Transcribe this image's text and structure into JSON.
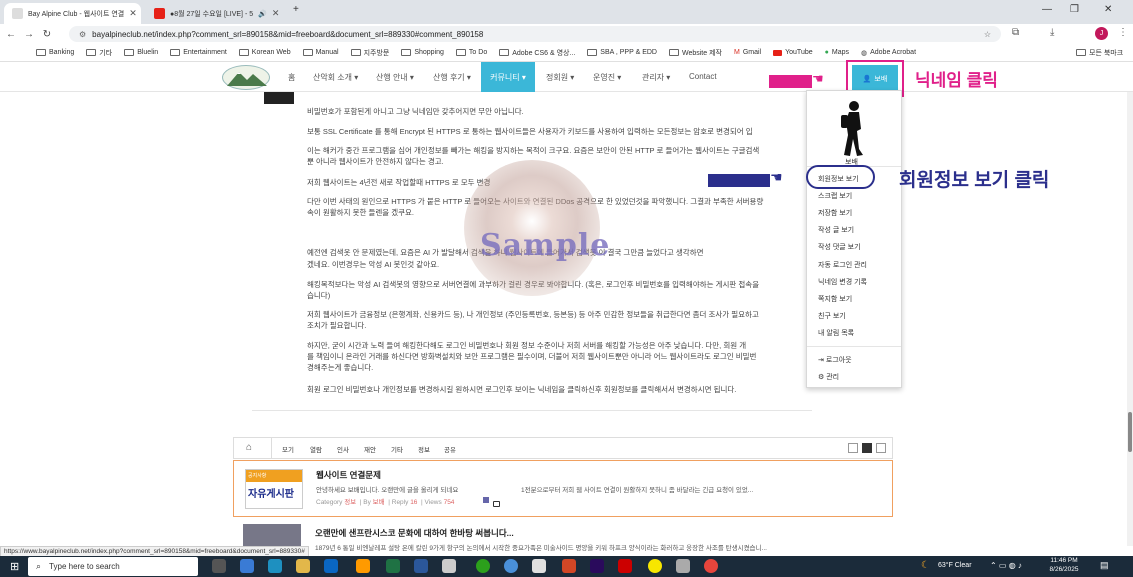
{
  "browser": {
    "tabs": [
      {
        "label": "Bay Alpine Club - 웹사이트 연결",
        "active": true
      },
      {
        "label": "●8월 27일 수요일 [LIVE] - 5",
        "active": false
      }
    ],
    "url": "bayalpineclub.net/index.php?comment_srl=890158&mid=freeboard&document_srl=889330#comment_890158",
    "bookmarks": [
      "Banking",
      "기타",
      "Bluelin",
      "Entertainment",
      "Korean Web",
      "Manual",
      "지주방문",
      "Shopping",
      "To Do",
      "Adobe CS6 & 영상...",
      "SBA , PPP & EDD",
      "Website 제작",
      "Gmail",
      "YouTube",
      "Maps",
      "Adobe Acrobat"
    ],
    "bookmarks_more": "모든 북마크",
    "status_url": "https://www.bayalpineclub.net/index.php?comment_srl=890158&mid=freeboard&document_srl=889330#"
  },
  "site": {
    "nav": [
      "홈",
      "산악회 소개 ▾",
      "산행 안내 ▾",
      "산행 후기 ▾",
      "커뮤니티 ▾",
      "정회원 ▾",
      "운영진 ▾",
      "관리자 ▾",
      "Contact"
    ],
    "user_button": "보배"
  },
  "article": {
    "lines": [
      "비밀번호가 포함된게 아니고 그냥 닉네임만 갖추어지면 무안 아닙니다.",
      "보통 SSL Certificate 를 통해 Encrypt 된 HTTPS 로 통하는 웹사이트들은 사용자가 키보드를 사용하여 입력하는 모든정보는 암호로 변경되어 입",
      "이는 해커가 중간 프로그램을 심어 개인정보를 빼가는 해킹을 방지하는 목적이 크구요. 요즘은 보안이 안된 HTTP 로 들어가는 웹사이트는 구글검색",
      "뿐 아니라 웹사이트가 안전하지 않다는 경고.",
      "저희 웹사이트는 4년전 새로 작업할때 HTTPS 로 모두 변경",
      "다만 이번 사태의 원인으로 HTTPS 가 붙은 HTTP 로 들어오는 사이트와 연결된 DDos 공격으로 한 있었던것을 파악했니다. 그결과 부족한 서버용량",
      "속이 원활하지 못한 들렌을 겠쿠요.",
      "예전엔 검색옷 안 문제였는데, 요즘은 AI 가 발달해서 검색을 하니 웹사이트에 들어가서 검색못 이 결국 그만큼 늘었다고 생각하면",
      "겠네요. 이번경우는 악성 AI 봇인것 같아요.",
      "해킹목적보다는 악성 AI 검색봇의 영향으로 서버연결에 과부하가 걸린 경우로 봐야합니다. (혹은, 로그인후 비밀번호를 입력해야하는 게시판 접속을",
      "습니다)",
      "저희 웹사이트가 금융정보 (은행계좌, 신용카드 등), 나 개인정보 (주민등록번호, 등본등) 등 아주 민감한 정보들을 취급한다면 좀더 조사가 필요하고",
      "조치가 필요합니다.",
      "하지만, 굳이 시간과 노력 들여 해킹한다해도 로그인 비밀번호나 회원 정보 수준이나 저희 서버를 해킹할 가능성은 아주 낮습니다. 다만, 회원 개",
      "를 책임이니 온라인 거래를 하신다면 방화벽설치와 보안 프로그램은 필수이며, 더불어 저희 웹사이트뿐만 아니라 어느 웹사이트라도 로그인 비밀번",
      "경해주는게 좋습니다.",
      "회원 로그인 비밀번호나 개인정보를 변경하시길 원하시면 로그인후 보이는 닉네임을 클릭하신후 회원정보를 클릭해서서 변경하시면 됩니다."
    ],
    "watermark": "Sample"
  },
  "dropdown": {
    "name": "보배",
    "items": [
      "회원정보 보기",
      "스크랩 보기",
      "저장함 보기",
      "작성 글 보기",
      "작성 댓글 보기",
      "자동 로그인 관리",
      "닉네임 변경 기록",
      "쪽지함 보기",
      "친구 보기",
      "내 알림 목록"
    ],
    "logout": "로그아웃",
    "admin": "관리"
  },
  "annotations": {
    "nickname_click": "닉네임 클릭",
    "member_info_click": "회원정보 보기 클릭"
  },
  "board": {
    "tabs": [
      "모기",
      "열람",
      "인사",
      "재안",
      "기타",
      "정보",
      "공유"
    ],
    "post1": {
      "thumb_tag": "공지사항",
      "thumb_text": "자유게시판",
      "title": "웹사이트 연결문제",
      "excerpt": "안녕하세요 보배입니다. 오랜만에 글을 올리게 되네요",
      "excerpt_right": "1전분으로부터 저희 웹 사이트 연결이 원활하지 못하니 좀 바달라는 긴급 요청이 있었...",
      "category_label": "Category",
      "category": "정보",
      "by_label": "By",
      "author": "보배",
      "reply_label": "Reply",
      "replies": "16",
      "views_label": "Views",
      "views": "754"
    },
    "post2": {
      "title": "오랜만에 샌프란시스코 문화에 대하여 한바탕 써봅니다...",
      "excerpt": "1879년 6 통일 비엔날레프 설탕 온에 칼린 9가게 항구의 논의에서 시작한 중요가족은 미술사이드 명양을 키워 하프크 양식이라는 화러하고 웅장한 사조를 탄생시켰습니..."
    }
  },
  "taskbar": {
    "search_placeholder": "Type here to search",
    "weather": "63°F  Clear",
    "time": "11:46 PM",
    "date": "8/26/2025"
  },
  "colors": {
    "accent": "#3bb7d8",
    "annotation_pink": "#e0208a",
    "annotation_blue": "#2b2f8c",
    "post_border": "#f0a060"
  }
}
